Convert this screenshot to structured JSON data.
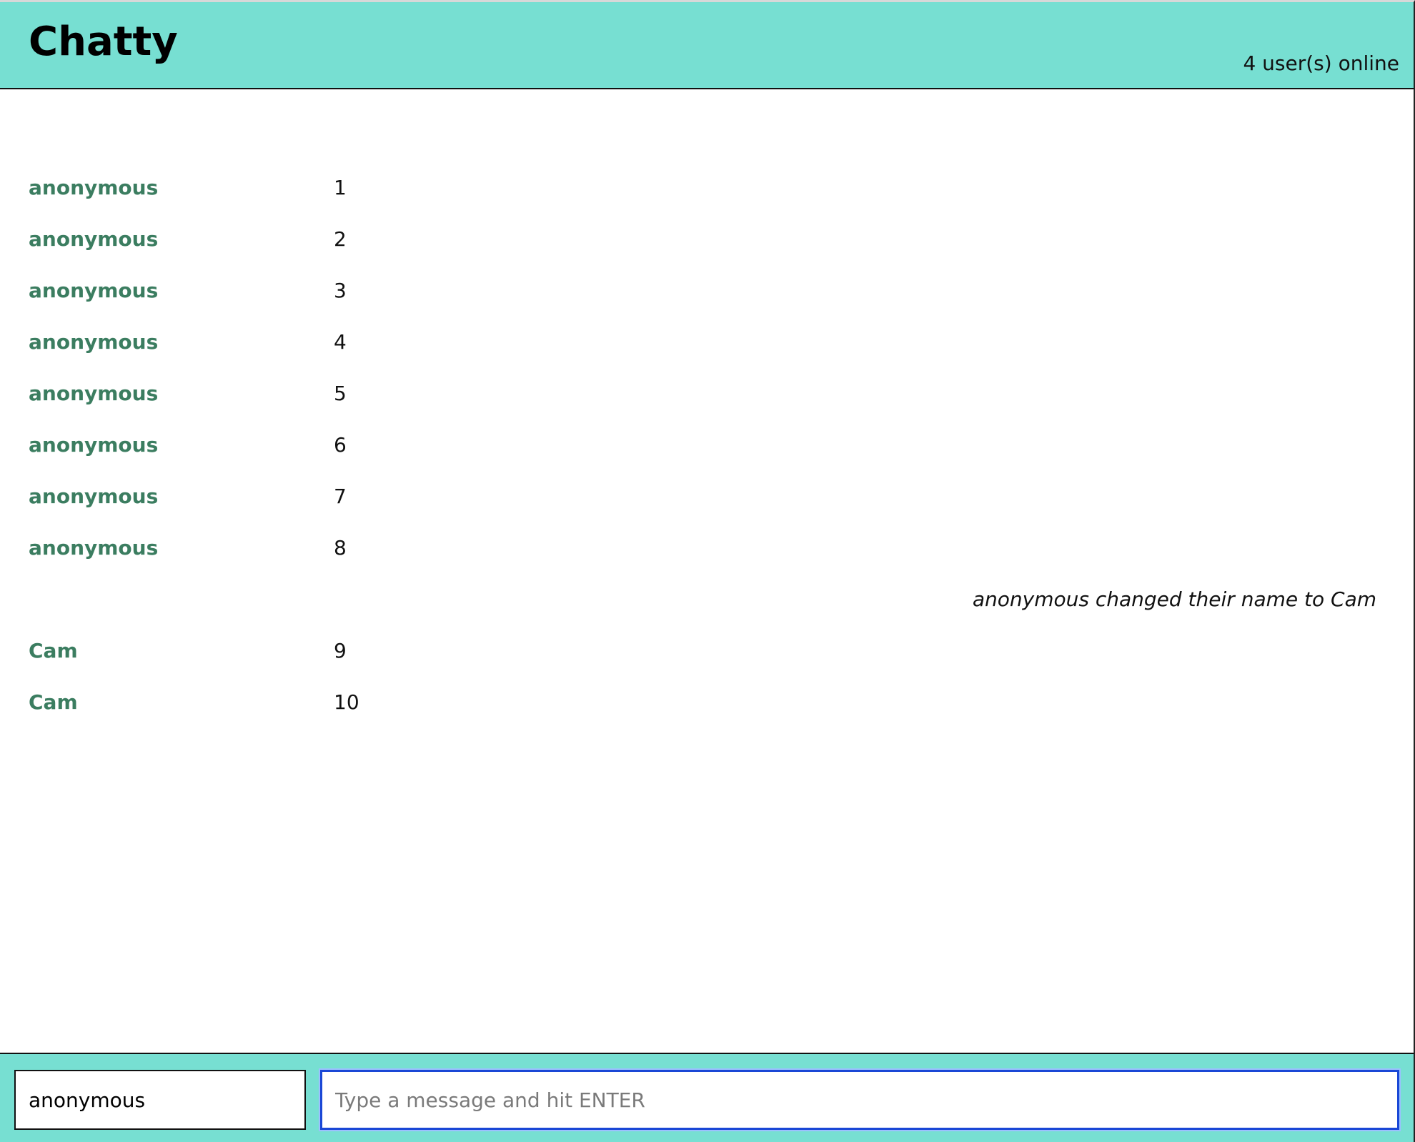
{
  "header": {
    "title": "Chatty",
    "online_status": "4 user(s) online"
  },
  "messages": [
    {
      "user": "anonymous",
      "text": "1"
    },
    {
      "user": "anonymous",
      "text": "2"
    },
    {
      "user": "anonymous",
      "text": "3"
    },
    {
      "user": "anonymous",
      "text": "4"
    },
    {
      "user": "anonymous",
      "text": "5"
    },
    {
      "user": "anonymous",
      "text": "6"
    },
    {
      "user": "anonymous",
      "text": "7"
    },
    {
      "user": "anonymous",
      "text": "8"
    }
  ],
  "notice": "anonymous changed their name to Cam",
  "messages_after": [
    {
      "user": "Cam",
      "text": "9"
    },
    {
      "user": "Cam",
      "text": "10"
    }
  ],
  "footer": {
    "name_value": "anonymous",
    "message_placeholder": "Type a message and hit ENTER"
  },
  "colors": {
    "accent": "#77dfd2",
    "username": "#3b7d60",
    "focus_border": "#1a47d6"
  }
}
